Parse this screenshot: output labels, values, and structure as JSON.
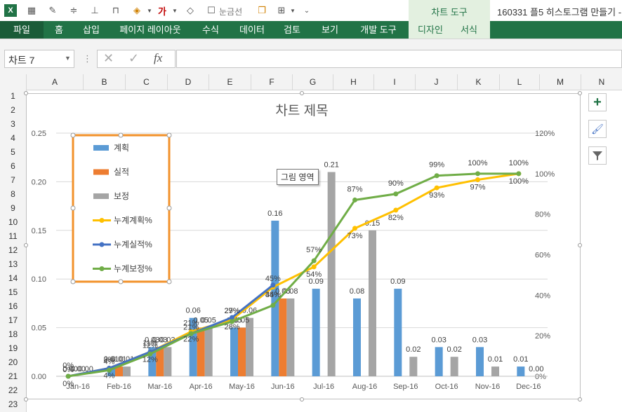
{
  "app": {
    "title": "160331 플5 히스토그램 만들기 -"
  },
  "qat": {
    "border_label": "눈금선"
  },
  "ribbon": {
    "context_group": "차트 도구",
    "tabs": [
      "파일",
      "홈",
      "삽입",
      "페이지 레이아웃",
      "수식",
      "데이터",
      "검토",
      "보기",
      "개발 도구"
    ],
    "context_tabs": [
      "디자인",
      "서식"
    ]
  },
  "formula_bar": {
    "name_box": "차트 7",
    "cancel": "✕",
    "enter": "✓",
    "fx": "fx",
    "value": ""
  },
  "columns": [
    "A",
    "B",
    "C",
    "D",
    "E",
    "F",
    "G",
    "H",
    "I",
    "J",
    "K",
    "L",
    "M",
    "N"
  ],
  "rows": [
    "1",
    "2",
    "3",
    "4",
    "5",
    "6",
    "7",
    "8",
    "9",
    "10",
    "11",
    "12",
    "13",
    "14",
    "15",
    "16",
    "17",
    "18",
    "19",
    "20",
    "21",
    "22",
    "23"
  ],
  "tooltip": "그림 영역",
  "colors": {
    "plan": "#5b9bd5",
    "actual": "#ed7d31",
    "corrected": "#a5a5a5",
    "cum_plan": "#ffc000",
    "cum_actual": "#4472c4",
    "cum_corrected": "#70ad47",
    "excel_green": "#217346",
    "legend_border": "#f2922b"
  },
  "chart_data": {
    "type": "bar",
    "title": "차트 제목",
    "categories": [
      "Jan-16",
      "Feb-16",
      "Mar-16",
      "Apr-16",
      "May-16",
      "Jun-16",
      "Jul-16",
      "Aug-16",
      "Sep-16",
      "Oct-16",
      "Nov-16",
      "Dec-16"
    ],
    "y_ticks": [
      "0.00",
      "0.05",
      "0.10",
      "0.15",
      "0.20",
      "0.25"
    ],
    "y2_ticks": [
      "0%",
      "20%",
      "40%",
      "60%",
      "80%",
      "100%",
      "120%"
    ],
    "ylim": [
      0,
      0.25
    ],
    "y2lim": [
      0,
      1.2
    ],
    "legend_position": "top-left",
    "series": [
      {
        "name": "계획",
        "kind": "bar",
        "values": [
          0.0,
          0.01,
          0.03,
          0.06,
          0.05,
          0.16,
          0.09,
          0.08,
          0.09,
          0.03,
          0.03,
          0.01
        ]
      },
      {
        "name": "실적",
        "kind": "bar",
        "values": [
          0.0,
          0.01,
          0.03,
          0.05,
          0.05,
          0.08,
          null,
          null,
          null,
          null,
          null,
          null
        ]
      },
      {
        "name": "보정",
        "kind": "bar",
        "values": [
          0.0,
          0.01,
          0.03,
          0.05,
          0.06,
          0.08,
          0.21,
          0.15,
          0.02,
          0.02,
          0.01,
          0.0
        ]
      },
      {
        "name": "누계계획%",
        "kind": "line",
        "values": [
          0.0,
          0.04,
          0.12,
          0.22,
          0.28,
          0.44,
          0.54,
          0.73,
          0.82,
          0.93,
          0.97,
          1.0
        ]
      },
      {
        "name": "누계실적%",
        "kind": "line",
        "values": [
          0.0,
          0.04,
          0.12,
          0.21,
          0.29,
          0.45,
          null,
          null,
          null,
          null,
          null,
          null
        ]
      },
      {
        "name": "누계보정%",
        "kind": "line",
        "values": [
          0.0,
          0.03,
          0.11,
          0.21,
          0.27,
          0.35,
          0.57,
          0.87,
          0.9,
          0.99,
          1.0,
          1.0
        ]
      }
    ],
    "bar_labels": [
      {
        "series": 0,
        "labels": [
          "0.00",
          "0.01",
          "0.03",
          "0.06",
          "0.05",
          "0.16",
          "0.09",
          "0.08",
          "0.09",
          "0.03",
          "0.03",
          "0.01"
        ]
      },
      {
        "series": 1,
        "labels": [
          "0.00",
          "0.01",
          "0.03",
          "0.05",
          "0.05",
          "0.08",
          "",
          "",
          "",
          "",
          "",
          ""
        ]
      },
      {
        "series": 2,
        "labels": [
          "0.00",
          "0.01",
          "0.03",
          "0.05",
          "0.06",
          "0.08",
          "0.21",
          "0.15",
          "0.02",
          "0.02",
          "0.01",
          "0.00"
        ]
      }
    ],
    "line_labels": [
      {
        "series": 3,
        "labels": [
          "0%",
          "4%",
          "12%",
          "22%",
          "28%",
          "44%",
          "54%",
          "73%",
          "82%",
          "93%",
          "97%",
          "100%"
        ]
      },
      {
        "series": 4,
        "labels": [
          "0%",
          "4%",
          "12%",
          "21%",
          "29%",
          "45%",
          "",
          "",
          "",
          "",
          "",
          ""
        ]
      },
      {
        "series": 5,
        "labels": [
          "0%",
          "3%",
          "11%",
          "21%",
          "27%",
          "35%",
          "57%",
          "87%",
          "90%",
          "99%",
          "100%",
          "100%"
        ]
      }
    ]
  }
}
